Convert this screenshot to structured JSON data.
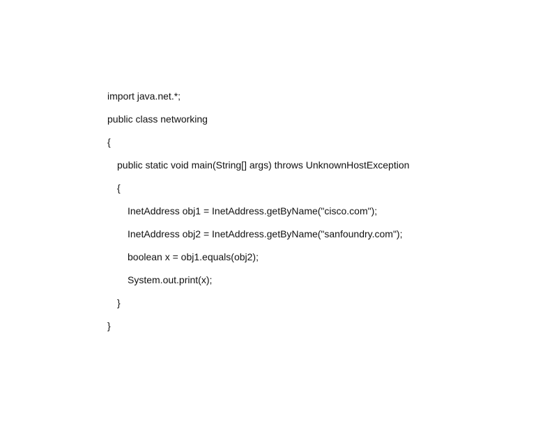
{
  "document": {
    "code_lines": [
      {
        "text": "import java.net.*;"
      },
      {
        "text": "public class networking"
      },
      {
        "text": "{"
      },
      {
        "text": "public static void main(String[] args) throws UnknownHostException"
      },
      {
        "text": "{"
      },
      {
        "text": "InetAddress obj1 = InetAddress.getByName(\"cisco.com\");"
      },
      {
        "text": "InetAddress obj2 = InetAddress.getByName(\"sanfoundry.com\");"
      },
      {
        "text": "boolean x = obj1.equals(obj2);"
      },
      {
        "text": "System.out.print(x);"
      },
      {
        "text": "}"
      },
      {
        "text": "}"
      }
    ]
  }
}
